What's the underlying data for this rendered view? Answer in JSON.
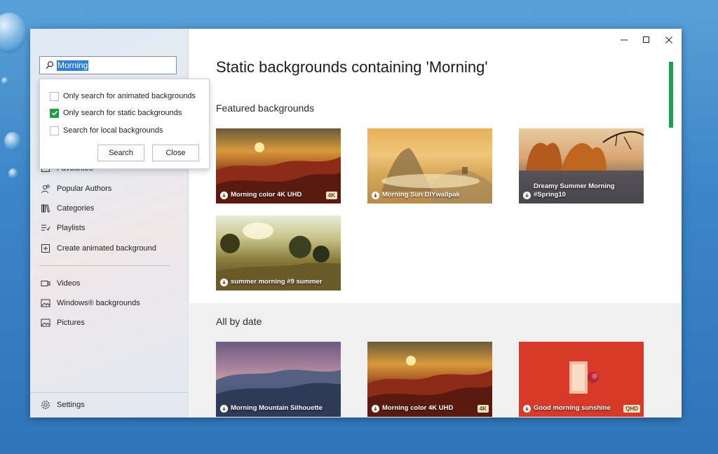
{
  "search": {
    "value": "Morning"
  },
  "popup": {
    "options": [
      {
        "label": "Only search for animated backgrounds",
        "checked": false
      },
      {
        "label": "Only search for static backgrounds",
        "checked": true
      },
      {
        "label": "Search for local backgrounds",
        "checked": false
      }
    ],
    "search_button": "Search",
    "close_button": "Close"
  },
  "sidebar": {
    "items": [
      {
        "label": "Favourites",
        "icon": "heart-icon"
      },
      {
        "label": "Popular Authors",
        "icon": "people-icon"
      },
      {
        "label": "Categories",
        "icon": "books-icon"
      },
      {
        "label": "Playlists",
        "icon": "playlist-icon"
      },
      {
        "label": "Create animated background",
        "icon": "add-box-icon"
      }
    ],
    "local_items": [
      {
        "label": "Videos",
        "icon": "video-icon"
      },
      {
        "label": "Windows® backgrounds",
        "icon": "image-icon"
      },
      {
        "label": "Pictures",
        "icon": "picture-icon"
      }
    ],
    "settings": "Settings"
  },
  "main": {
    "title": "Static backgrounds containing 'Morning'",
    "featured_title": "Featured backgrounds",
    "featured": [
      {
        "title": "Morning color 4K UHD",
        "badge": "4K"
      },
      {
        "title": "Morning Sun DIYwallpak",
        "badge": ""
      },
      {
        "title": "Dreamy Summer Morning #Spring10",
        "badge": ""
      },
      {
        "title": "summer morning #9 summer",
        "badge": ""
      }
    ],
    "all_title": "All by date",
    "all": [
      {
        "title": "Morning Mountain Silhouette",
        "badge": ""
      },
      {
        "title": "Morning color 4K UHD",
        "badge": "4K"
      },
      {
        "title": "Good morning sunshine",
        "badge": "QHD"
      }
    ]
  },
  "colors": {
    "accent_green": "#1e9e47",
    "selection_blue": "#2e7fd6"
  }
}
